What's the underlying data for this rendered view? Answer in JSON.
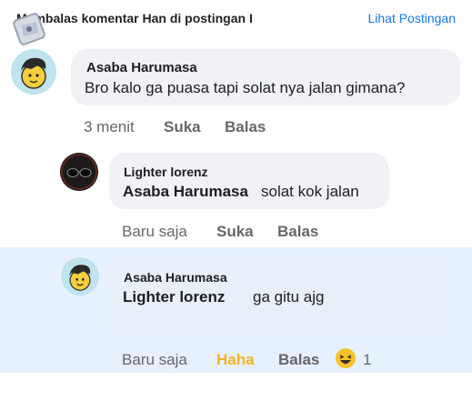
{
  "header": {
    "title": "Membalas komentar Han di postingan I",
    "link": "Lihat Postingan"
  },
  "comment1": {
    "author": "Asaba Harumasa",
    "text": "Bro kalo ga puasa tapi solat nya jalan gimana?",
    "time": "3 menit",
    "like": "Suka",
    "reply": "Balas"
  },
  "comment2": {
    "author": "Lighter lorenz",
    "mention": "Asaba Harumasa",
    "text": "solat kok jalan",
    "time": "Baru saja",
    "like": "Suka",
    "reply": "Balas"
  },
  "comment3": {
    "author": "Asaba Harumasa",
    "mention": "Lighter lorenz",
    "text": "ga gitu ajg",
    "time": "Baru saja",
    "reaction_label": "Haha",
    "reply": "Balas",
    "reaction_count": "1",
    "reaction_icon": "laughing-emoji-icon"
  },
  "colors": {
    "accent": "#1877f2",
    "bubble": "#f0f2f5",
    "highlight": "#e7f0fd",
    "haha": "#f7b125"
  }
}
